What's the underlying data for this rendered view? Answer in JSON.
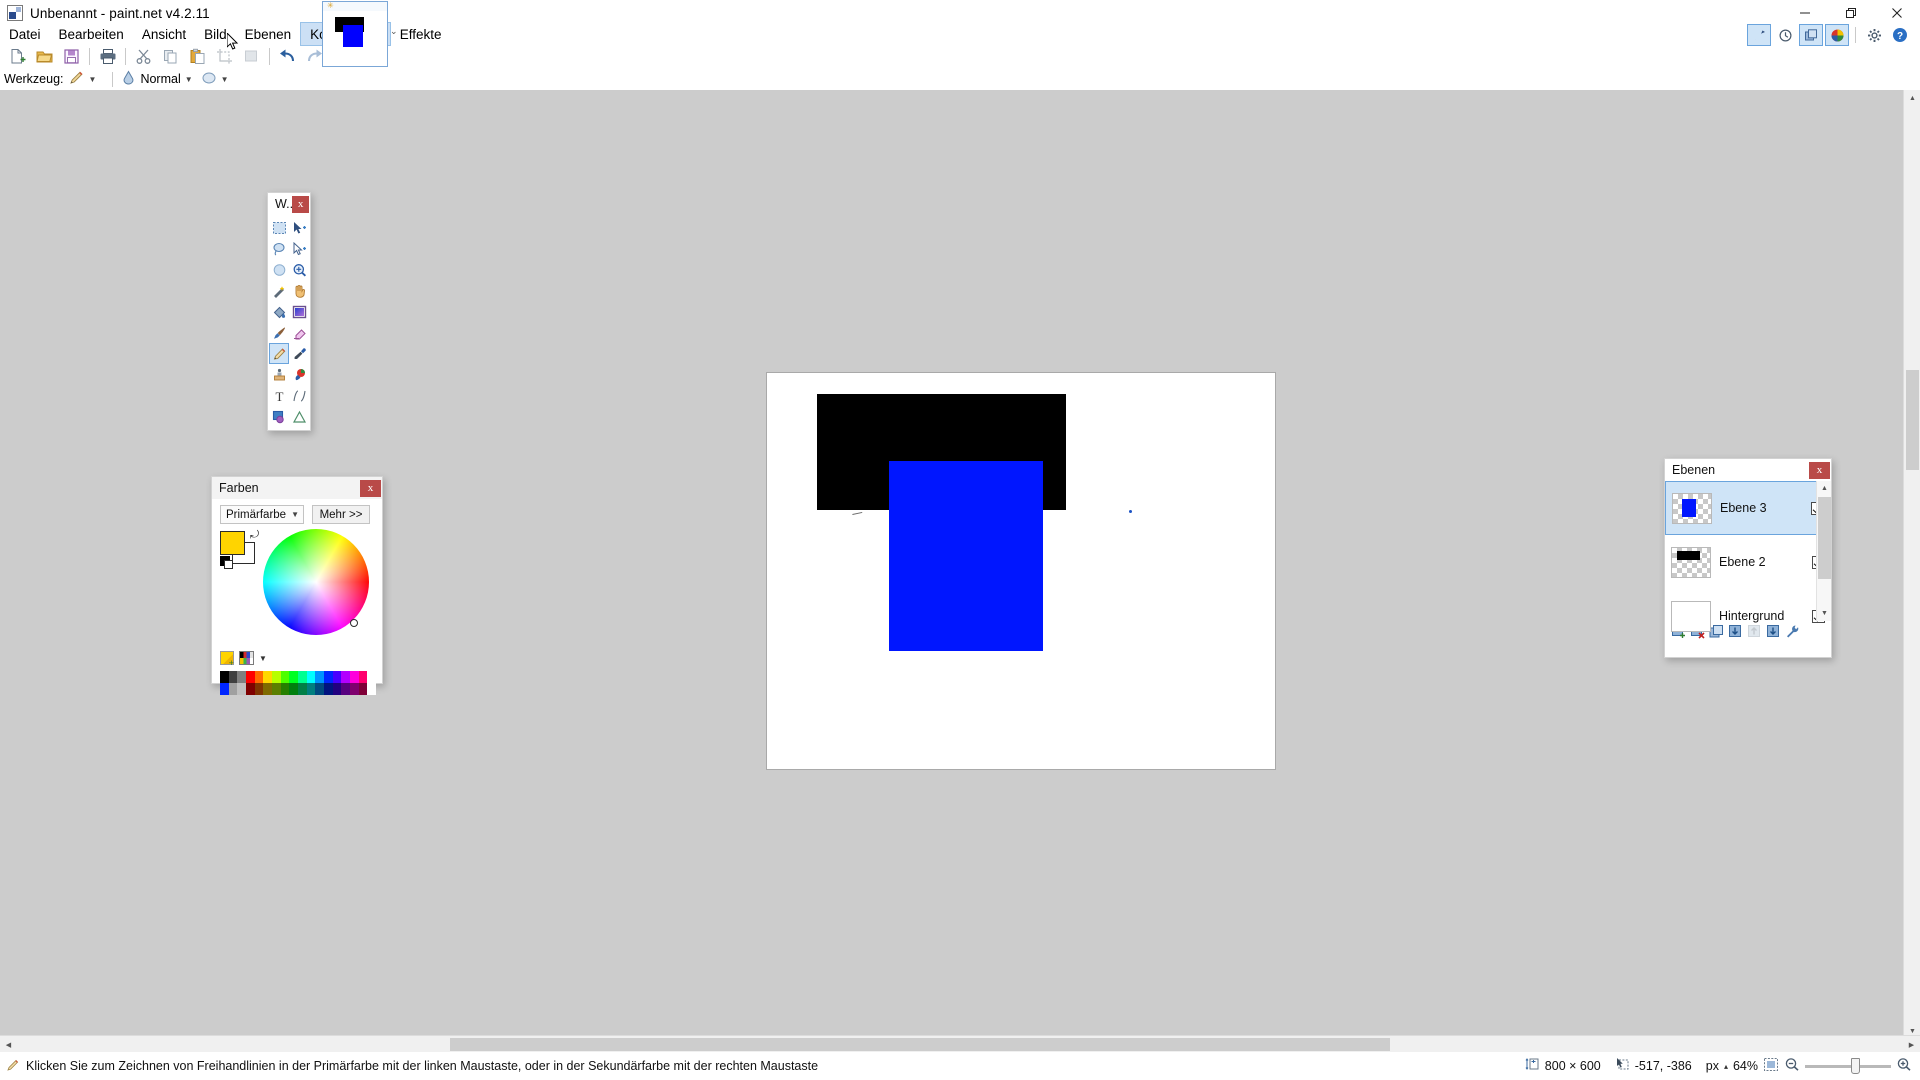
{
  "window": {
    "title": "Unbenannt - paint.net v4.2.11",
    "icon": "app-icon",
    "controls": [
      {
        "name": "minimize",
        "glyph": "–"
      },
      {
        "name": "maximize",
        "glyph": "❐"
      },
      {
        "name": "close",
        "glyph": "✕"
      }
    ]
  },
  "menubar": {
    "items": [
      {
        "label": "Datei",
        "highlighted": false
      },
      {
        "label": "Bearbeiten",
        "highlighted": false
      },
      {
        "label": "Ansicht",
        "highlighted": false
      },
      {
        "label": "Bild",
        "highlighted": false
      },
      {
        "label": "Ebenen",
        "highlighted": false
      },
      {
        "label": "Korrekturen",
        "highlighted": true
      },
      {
        "label": "Effekte",
        "highlighted": false
      }
    ]
  },
  "toolbar": {
    "buttons": [
      {
        "name": "new-icon"
      },
      {
        "name": "open-icon"
      },
      {
        "name": "save-icon"
      },
      {
        "name": "print-icon"
      },
      {
        "name": "cut-icon"
      },
      {
        "name": "copy-icon"
      },
      {
        "name": "paste-icon"
      },
      {
        "name": "crop-to-selection-icon"
      },
      {
        "name": "deselect-icon"
      },
      {
        "name": "undo-icon"
      },
      {
        "name": "redo-icon"
      },
      {
        "name": "grid-icon"
      },
      {
        "name": "rulers-icon"
      }
    ]
  },
  "toolbar_right": {
    "buttons": [
      {
        "name": "tools-window-icon"
      },
      {
        "name": "history-window-icon"
      },
      {
        "name": "layers-window-icon"
      },
      {
        "name": "colors-window-icon"
      },
      {
        "name": "settings-icon"
      },
      {
        "name": "help-icon"
      }
    ]
  },
  "tooloptions": {
    "label": "Werkzeug:",
    "tool_icon": "pencil-icon",
    "blend_icon": "blend-mode-icon",
    "blend_label": "Normal",
    "antialias_icon": "antialiasing-icon"
  },
  "thumbstrip": {
    "image_label": "document-thumbnail",
    "overflow_chevron": "⌄"
  },
  "tools_window": {
    "title": "W...",
    "close_label": "x",
    "tools": [
      {
        "name": "rectangle-select-tool",
        "selected": false
      },
      {
        "name": "move-selected-tool",
        "selected": false
      },
      {
        "name": "lasso-select-tool",
        "selected": false
      },
      {
        "name": "move-selection-tool",
        "selected": false
      },
      {
        "name": "ellipse-select-tool",
        "selected": false
      },
      {
        "name": "zoom-tool",
        "selected": false
      },
      {
        "name": "magic-wand-tool",
        "selected": false
      },
      {
        "name": "pan-tool",
        "selected": false
      },
      {
        "name": "paint-bucket-tool",
        "selected": false
      },
      {
        "name": "gradient-tool",
        "selected": false
      },
      {
        "name": "paintbrush-tool",
        "selected": false
      },
      {
        "name": "eraser-tool",
        "selected": false
      },
      {
        "name": "pencil-tool",
        "selected": true
      },
      {
        "name": "color-picker-tool",
        "selected": false
      },
      {
        "name": "clone-stamp-tool",
        "selected": false
      },
      {
        "name": "recolor-tool",
        "selected": false
      },
      {
        "name": "text-tool",
        "selected": false
      },
      {
        "name": "line-curve-tool",
        "selected": false
      },
      {
        "name": "shapes-tool",
        "selected": false
      },
      {
        "name": "shapes-extra-tool",
        "selected": false
      }
    ]
  },
  "colors_window": {
    "title": "Farben",
    "close_label": "x",
    "mode_value": "Primärfarbe",
    "more_label": "Mehr >>",
    "primary_color": "#ffd400",
    "secondary_color": "#ffffff",
    "reset_black": "#000000",
    "reset_white": "#ffffff",
    "swap_icon": "swap-colors-icon",
    "add_swatch_icon": "add-to-palette-icon",
    "palette_icon": "palette-icon",
    "palette_dropdown_icon": "chevron-down-icon",
    "palette_row1": [
      "#000000",
      "#404040",
      "#808080",
      "#ff0000",
      "#ff6a00",
      "#ffd800",
      "#b6ff00",
      "#4cff00",
      "#00ff21",
      "#00ff90",
      "#00ffff",
      "#0094ff",
      "#0026ff",
      "#4800ff",
      "#b200ff",
      "#ff00dc",
      "#ff006e",
      "#ffffff"
    ],
    "palette_row2": [
      "#0026ff",
      "#a0a0a0",
      "#c0c0c0",
      "#7f0000",
      "#7f3300",
      "#7f6a00",
      "#5b7f00",
      "#267f00",
      "#007f0e",
      "#007f46",
      "#007f7f",
      "#004a7f",
      "#00137f",
      "#21007f",
      "#57007f",
      "#7f006e",
      "#7f0037",
      "#ffffff"
    ]
  },
  "layers_window": {
    "title": "Ebenen",
    "close_label": "x",
    "layers": [
      {
        "name": "Ebene 3",
        "visible": true,
        "selected": true,
        "thumb": "blue-square"
      },
      {
        "name": "Ebene 2",
        "visible": true,
        "selected": false,
        "thumb": "black-bar"
      },
      {
        "name": "Hintergrund",
        "visible": true,
        "selected": false,
        "thumb": "white"
      }
    ],
    "tool_buttons": [
      {
        "name": "add-layer-button"
      },
      {
        "name": "delete-layer-button"
      },
      {
        "name": "duplicate-layer-button"
      },
      {
        "name": "merge-layer-down-button"
      },
      {
        "name": "move-layer-up-button"
      },
      {
        "name": "move-layer-down-button"
      },
      {
        "name": "layer-properties-button"
      }
    ]
  },
  "canvas": {
    "black_rect_color": "#000000",
    "blue_rect_color": "#0016ff",
    "background_color": "#ffffff"
  },
  "statusbar": {
    "tool_icon": "pencil-icon",
    "hint": "Klicken Sie zum Zeichnen von Freihandlinien in der Primärfarbe mit der linken Maustaste, oder in der Sekundärfarbe mit der rechten Maustaste",
    "size_icon": "image-size-icon",
    "size": "800 × 600",
    "cursor_icon": "cursor-position-icon",
    "cursor": "-517, -386",
    "unit": "px",
    "unit_arrow": "▴",
    "zoom": "64%",
    "fit_icon": "fit-to-window-icon",
    "zoom_out_icon": "zoom-out-icon",
    "zoom_in_icon": "zoom-in-icon"
  }
}
